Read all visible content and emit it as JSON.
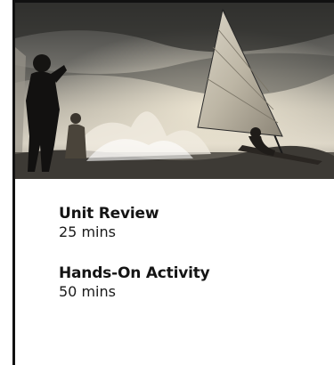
{
  "hero": {
    "image": "ice-sailing-photo"
  },
  "activities": [
    {
      "title": "Unit Review",
      "duration": "25 mins"
    },
    {
      "title": "Hands-On Activity",
      "duration": "50 mins"
    }
  ]
}
